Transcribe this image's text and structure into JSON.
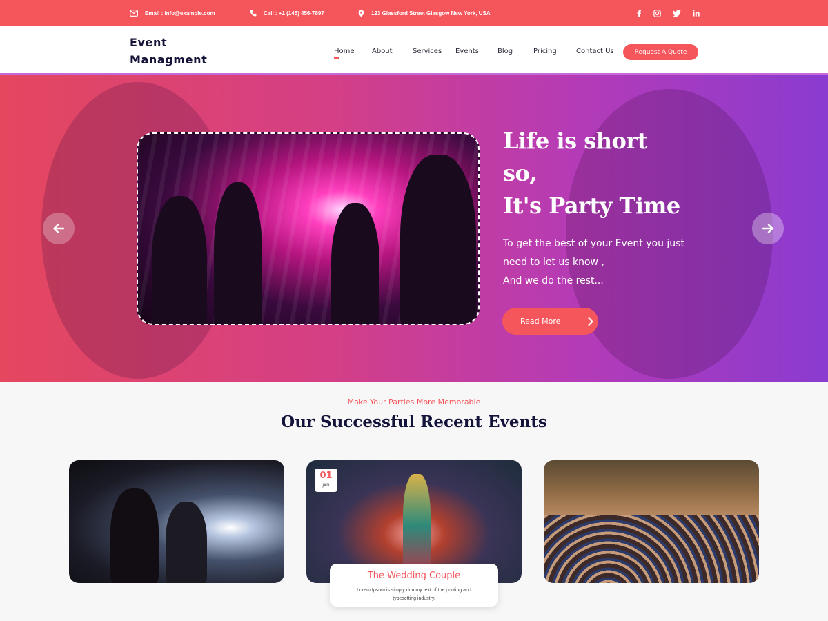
{
  "topbar": {
    "email": "Email : info@example.com",
    "call": "Call : +1 (145) 456-7897",
    "address": "123 Glassford Street Glasgow New York, USA",
    "socials": [
      "facebook-icon",
      "instagram-icon",
      "twitter-icon",
      "linkedin-icon"
    ]
  },
  "header": {
    "logo_line1": "Event",
    "logo_line2": "Managment",
    "nav": [
      "Home",
      "About",
      "Services",
      "Events",
      "Blog",
      "Pricing",
      "Contact Us"
    ],
    "active_nav": "Home",
    "quote_button": "Request A Quote"
  },
  "hero": {
    "title_line1": "Life is short",
    "title_line2": "so,",
    "title_line3": "It's Party Time",
    "text_line1": "To get the best of your Event you just",
    "text_line2": "need to let us know ,",
    "text_line3": "And we do the rest...",
    "button": "Read More"
  },
  "events": {
    "subtitle": "Make Your Parties More Memorable",
    "title": "Our Successful Recent Events",
    "date_day": "01",
    "date_month": "JAN",
    "card_title": "The Wedding Couple",
    "card_text": "Lorem Ipsum is simply dummy text of the printing and typesetting industry."
  },
  "colors": {
    "accent": "#f5565c",
    "dark": "#14133a"
  }
}
